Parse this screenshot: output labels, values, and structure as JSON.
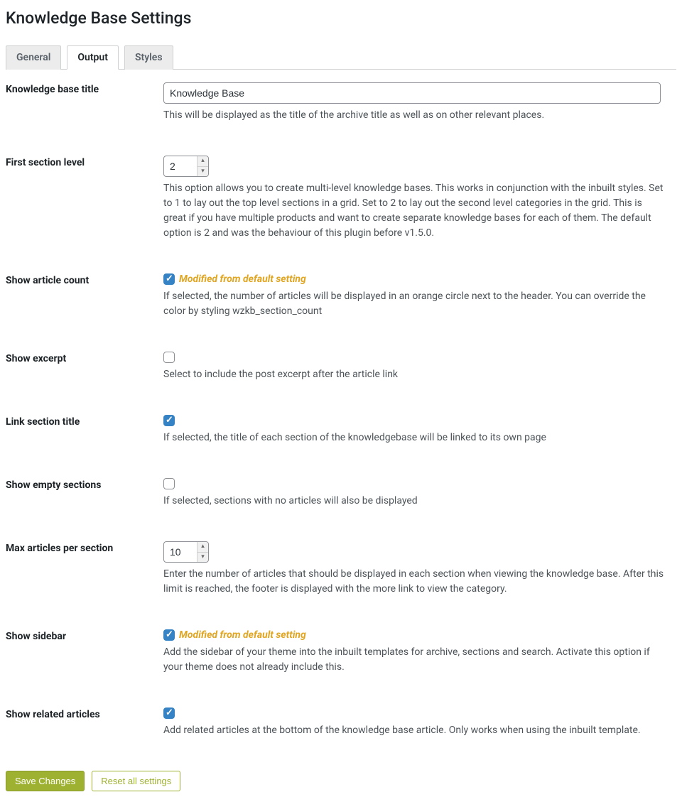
{
  "page_title": "Knowledge Base Settings",
  "tabs": [
    {
      "label": "General",
      "active": false
    },
    {
      "label": "Output",
      "active": true
    },
    {
      "label": "Styles",
      "active": false
    }
  ],
  "modified_label": "Modified from default setting",
  "fields": {
    "kb_title": {
      "label": "Knowledge base title",
      "value": "Knowledge Base",
      "desc": "This will be displayed as the title of the archive title as well as on other relevant places."
    },
    "first_section_level": {
      "label": "First section level",
      "value": "2",
      "desc": "This option allows you to create multi-level knowledge bases. This works in conjunction with the inbuilt styles. Set to 1 to lay out the top level sections in a grid. Set to 2 to lay out the second level categories in the grid. This is great if you have multiple products and want to create separate knowledge bases for each of them. The default option is 2 and was the behaviour of this plugin before v1.5.0."
    },
    "show_article_count": {
      "label": "Show article count",
      "checked": true,
      "modified": true,
      "desc": "If selected, the number of articles will be displayed in an orange circle next to the header. You can override the color by styling wzkb_section_count"
    },
    "show_excerpt": {
      "label": "Show excerpt",
      "checked": false,
      "desc": "Select to include the post excerpt after the article link"
    },
    "link_section_title": {
      "label": "Link section title",
      "checked": true,
      "desc": "If selected, the title of each section of the knowledgebase will be linked to its own page"
    },
    "show_empty_sections": {
      "label": "Show empty sections",
      "checked": false,
      "desc": "If selected, sections with no articles will also be displayed"
    },
    "max_articles": {
      "label": "Max articles per section",
      "value": "10",
      "desc": "Enter the number of articles that should be displayed in each section when viewing the knowledge base. After this limit is reached, the footer is displayed with the more link to view the category."
    },
    "show_sidebar": {
      "label": "Show sidebar",
      "checked": true,
      "modified": true,
      "desc": "Add the sidebar of your theme into the inbuilt templates for archive, sections and search. Activate this option if your theme does not already include this."
    },
    "show_related": {
      "label": "Show related articles",
      "checked": true,
      "desc": "Add related articles at the bottom of the knowledge base article. Only works when using the inbuilt template."
    }
  },
  "buttons": {
    "save": "Save Changes",
    "reset": "Reset all settings"
  }
}
